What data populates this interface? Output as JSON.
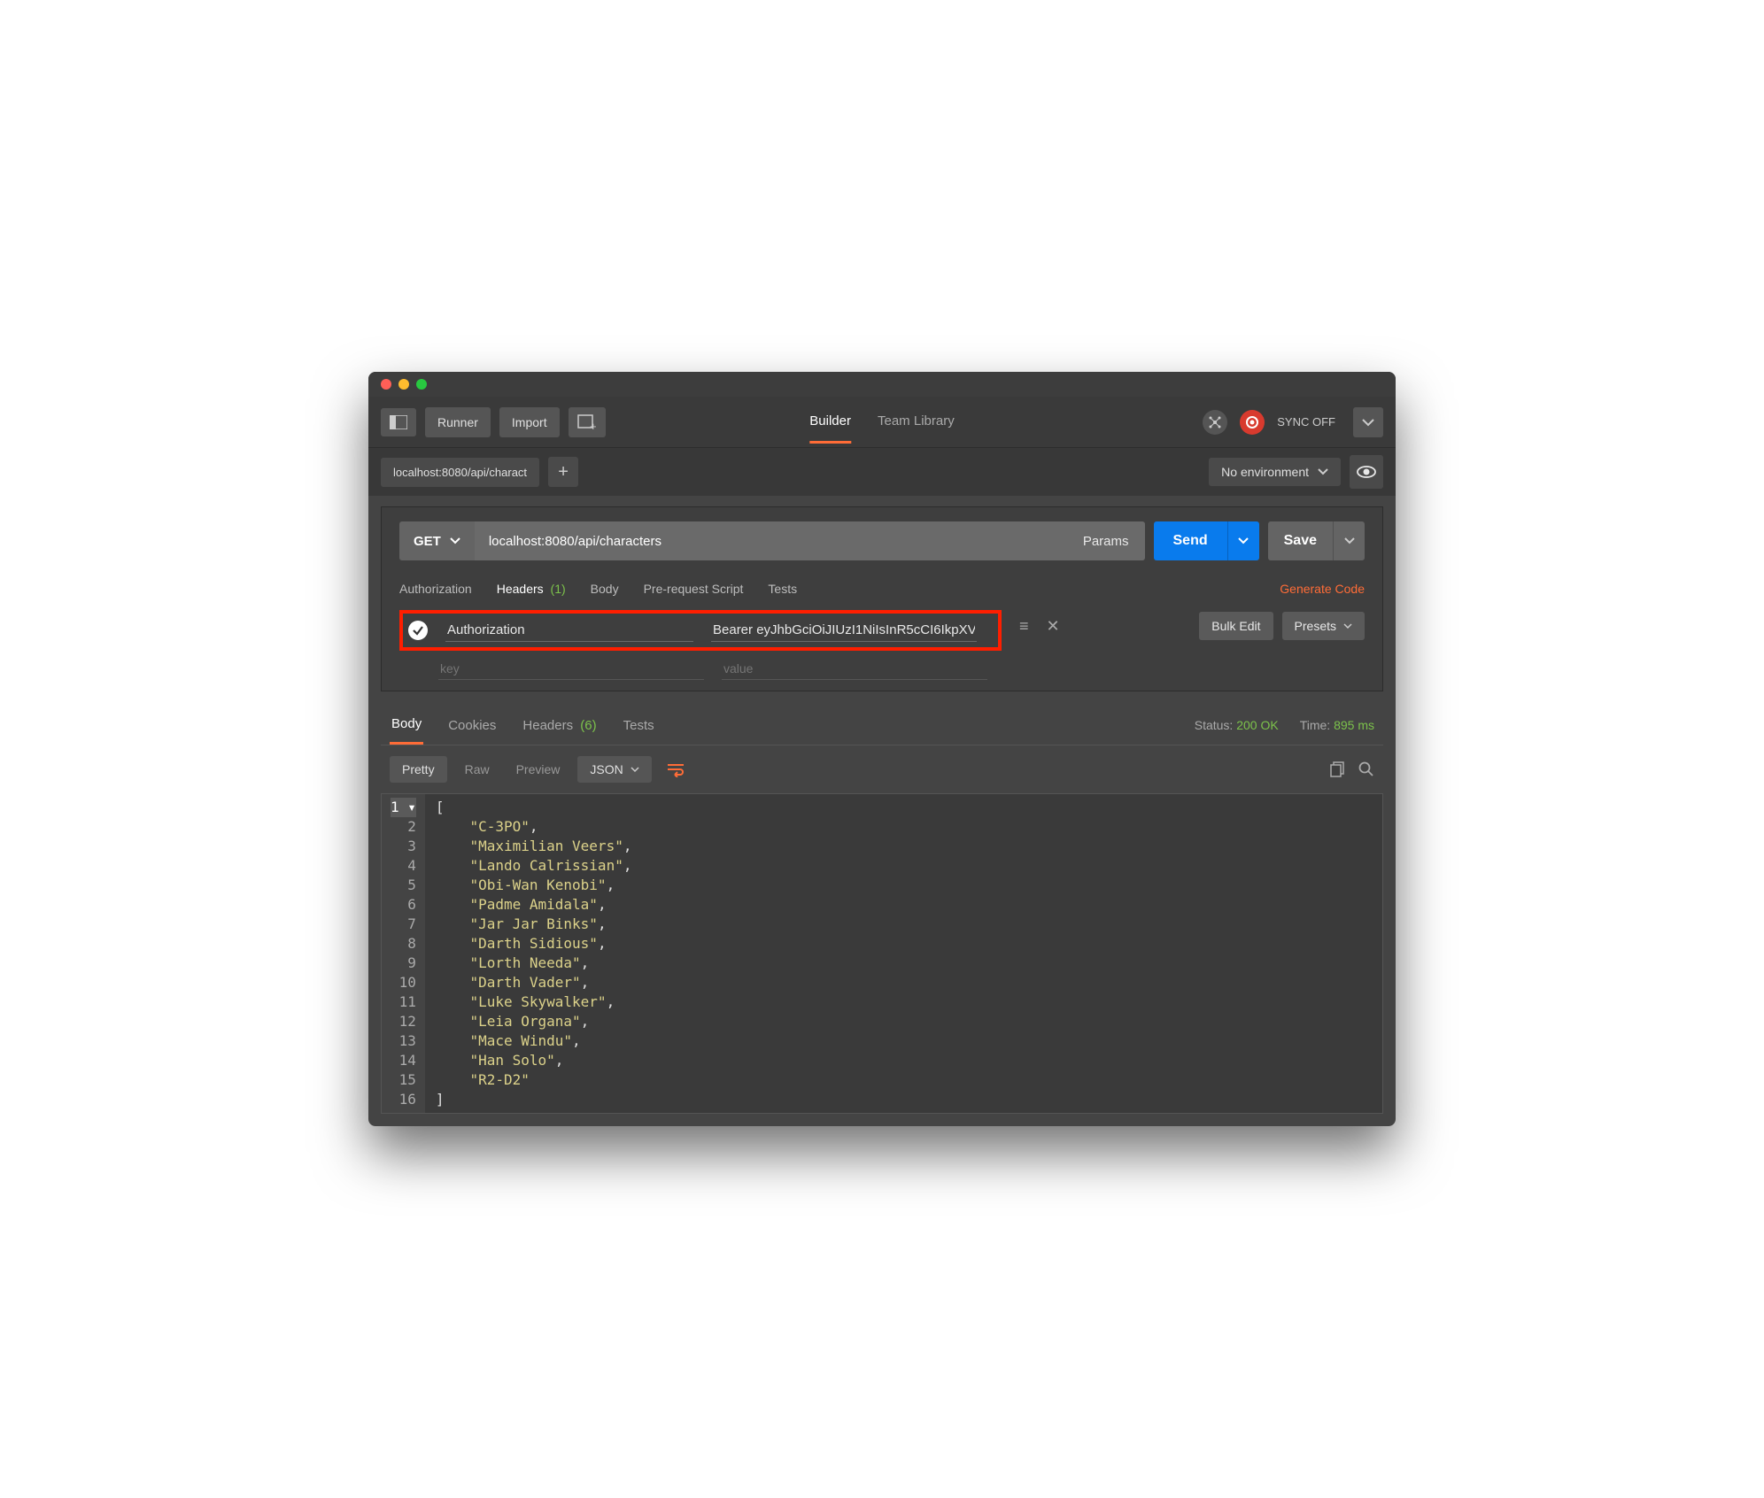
{
  "toolbar": {
    "runner": "Runner",
    "import": "Import",
    "builder": "Builder",
    "team_library": "Team Library",
    "sync_off": "SYNC OFF"
  },
  "tabstrip": {
    "tab_label": "localhost:8080/api/charact",
    "env_label": "No environment"
  },
  "request": {
    "method": "GET",
    "url": "localhost:8080/api/characters",
    "params": "Params",
    "send": "Send",
    "save": "Save",
    "tabs": {
      "authorization": "Authorization",
      "headers": "Headers",
      "headers_count": "(1)",
      "body": "Body",
      "prerequest": "Pre-request Script",
      "tests": "Tests"
    },
    "generate_code": "Generate Code",
    "header_row": {
      "key": "Authorization",
      "value": "Bearer eyJhbGciOiJIUzI1NiIsInR5cCI6IkpXV"
    },
    "placeholders": {
      "key": "key",
      "value": "value"
    },
    "bulk_edit": "Bulk Edit",
    "presets": "Presets"
  },
  "response": {
    "tabs": {
      "body": "Body",
      "cookies": "Cookies",
      "headers": "Headers",
      "headers_count": "(6)",
      "tests": "Tests"
    },
    "status_label": "Status:",
    "status_value": "200 OK",
    "time_label": "Time:",
    "time_value": "895 ms",
    "view": {
      "pretty": "Pretty",
      "raw": "Raw",
      "preview": "Preview",
      "format": "JSON"
    },
    "body_lines": [
      "[",
      "    \"C-3PO\",",
      "    \"Maximilian Veers\",",
      "    \"Lando Calrissian\",",
      "    \"Obi-Wan Kenobi\",",
      "    \"Padme Amidala\",",
      "    \"Jar Jar Binks\",",
      "    \"Darth Sidious\",",
      "    \"Lorth Needa\",",
      "    \"Darth Vader\",",
      "    \"Luke Skywalker\",",
      "    \"Leia Organa\",",
      "    \"Mace Windu\",",
      "    \"Han Solo\",",
      "    \"R2-D2\"",
      "]"
    ]
  }
}
